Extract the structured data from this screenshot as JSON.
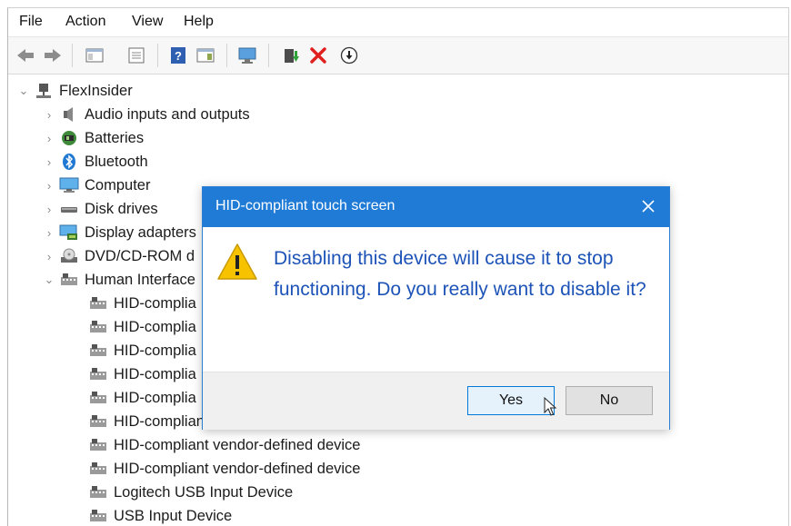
{
  "menu": [
    "File",
    "Action",
    "View",
    "Help"
  ],
  "toolbar": {
    "icons": [
      "back-arrow-icon",
      "forward-arrow-icon",
      "show-hide-console-tree-icon",
      "properties-icon",
      "help-icon",
      "action-pane-icon",
      "scan-hardware-icon",
      "update-driver-icon",
      "uninstall-device-icon",
      "disable-device-icon"
    ]
  },
  "tree": {
    "root": "FlexInsider",
    "categories": [
      {
        "label": "Audio inputs and outputs",
        "icon": "speaker-icon"
      },
      {
        "label": "Batteries",
        "icon": "battery-icon"
      },
      {
        "label": "Bluetooth",
        "icon": "bluetooth-icon"
      },
      {
        "label": "Computer",
        "icon": "monitor-icon"
      },
      {
        "label": "Disk drives",
        "icon": "disk-drive-icon"
      },
      {
        "label": "Display adapters",
        "icon": "display-adapter-icon"
      },
      {
        "label": "DVD/CD-ROM d",
        "icon": "dvd-drive-icon"
      },
      {
        "label": "Human Interface",
        "icon": "hid-icon"
      }
    ],
    "hid_devices": [
      "HID-complia",
      "HID-complia",
      "HID-complia",
      "HID-complia",
      "HID-complia",
      "HID-compliant vendor-defined device",
      "HID-compliant vendor-defined device",
      "HID-compliant vendor-defined device",
      "Logitech USB Input Device",
      "USB Input Device"
    ]
  },
  "dialog": {
    "title": "HID-compliant touch screen",
    "message": "Disabling this device will cause it to stop functioning. Do you really want to disable it?",
    "yes_label": "Yes",
    "no_label": "No"
  },
  "colors": {
    "dialog_title_bg": "#1f7bd6",
    "message_text": "#1d53b7",
    "warning_yellow": "#f7c300",
    "uninstall_red": "#e0201f"
  }
}
